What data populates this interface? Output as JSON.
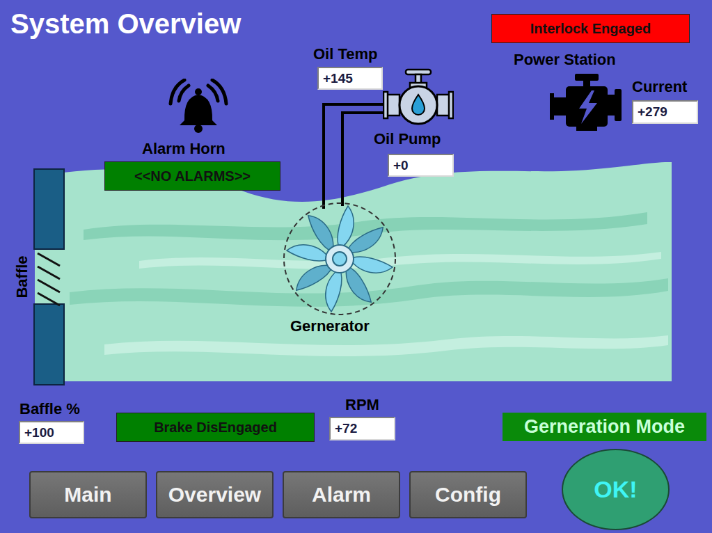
{
  "title": "System Overview",
  "interlock": {
    "label": "Interlock Engaged",
    "engaged": true
  },
  "power_station": {
    "label": "Power Station",
    "current_label": "Current",
    "current": "+279"
  },
  "oil_temp": {
    "label": "Oil Temp",
    "value": "+145"
  },
  "oil_pump": {
    "label": "Oil Pump",
    "value": "+0"
  },
  "alarm_horn": {
    "label": "Alarm Horn",
    "status": "<<NO ALARMS>>",
    "active": false
  },
  "generator": {
    "label": "Gernerator"
  },
  "baffle": {
    "label": "Baffle",
    "percent_label": "Baffle %",
    "percent": "+100"
  },
  "brake": {
    "label": "Brake DisEngaged",
    "engaged": false
  },
  "rpm": {
    "label": "RPM",
    "value": "+72"
  },
  "mode": {
    "label": "Gerneration Mode"
  },
  "nav": [
    {
      "label": "Main",
      "selected": false
    },
    {
      "label": "Overview",
      "selected": false
    },
    {
      "label": "Alarm",
      "selected": false
    },
    {
      "label": "Config",
      "selected": false
    }
  ],
  "ok_button": {
    "label": "OK!"
  }
}
